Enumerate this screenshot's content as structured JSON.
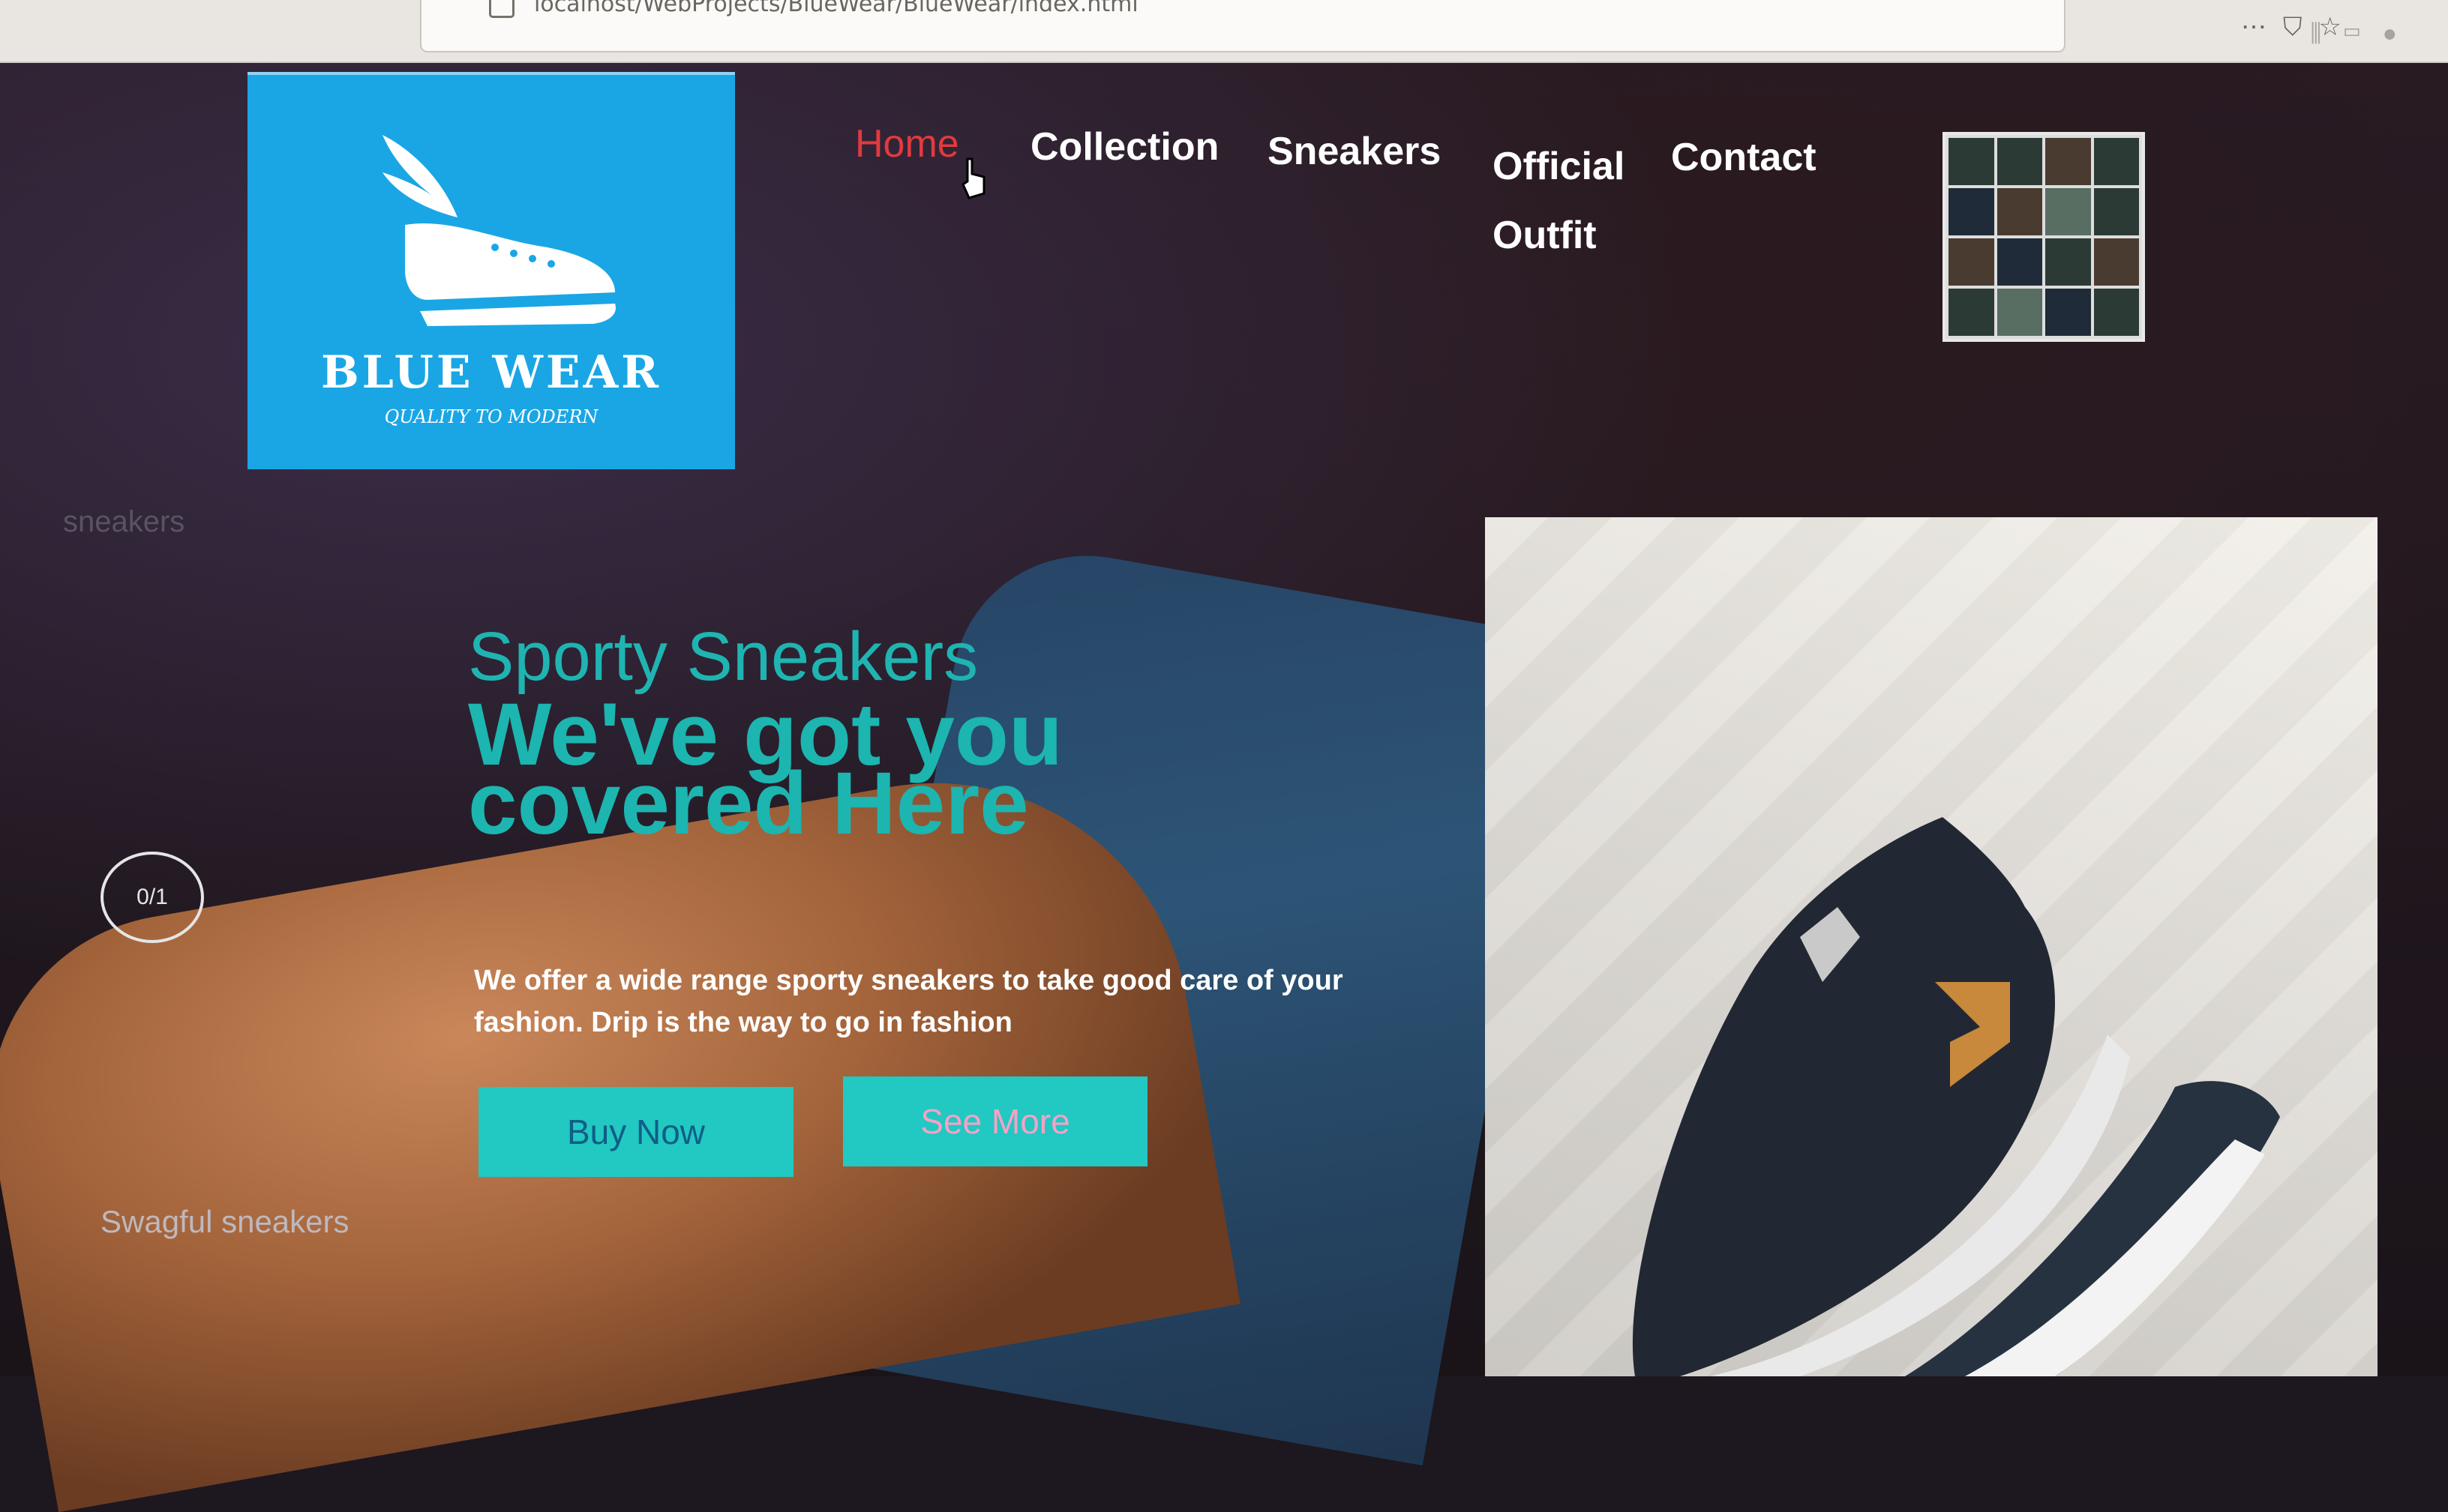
{
  "browser": {
    "url": "localhost/WebProjects/BlueWear/BlueWear/index.html",
    "toolbar_icons": [
      "more-icon",
      "pocket-icon",
      "bookmark-star-icon"
    ],
    "right_icons": [
      "library-icon",
      "sidebar-icon",
      "account-icon"
    ]
  },
  "logo": {
    "title": "BLUE WEAR",
    "tagline": "QUALITY TO MODERN",
    "background": "#1aa6e4"
  },
  "nav": {
    "items": [
      {
        "label": "Home",
        "active": true
      },
      {
        "label": "Collection"
      },
      {
        "label": "Sneakers"
      },
      {
        "label": "Official Outfit"
      },
      {
        "label": "Contact"
      }
    ],
    "active_color": "#e13a3f"
  },
  "side": {
    "label": "sneakers",
    "counter": "0/1",
    "bottom_label": "Swagful sneakers"
  },
  "hero": {
    "subtitle": "Sporty Sneakers",
    "title": "We've got you covered Here",
    "description": "We offer a wide range sporty sneakers to take good care of your fashion. Drip is the way to go in fashion",
    "buttons": {
      "buy": "Buy Now",
      "more": "See More"
    },
    "accent": "#1cb5b0",
    "button_color": "#22c8c2"
  }
}
